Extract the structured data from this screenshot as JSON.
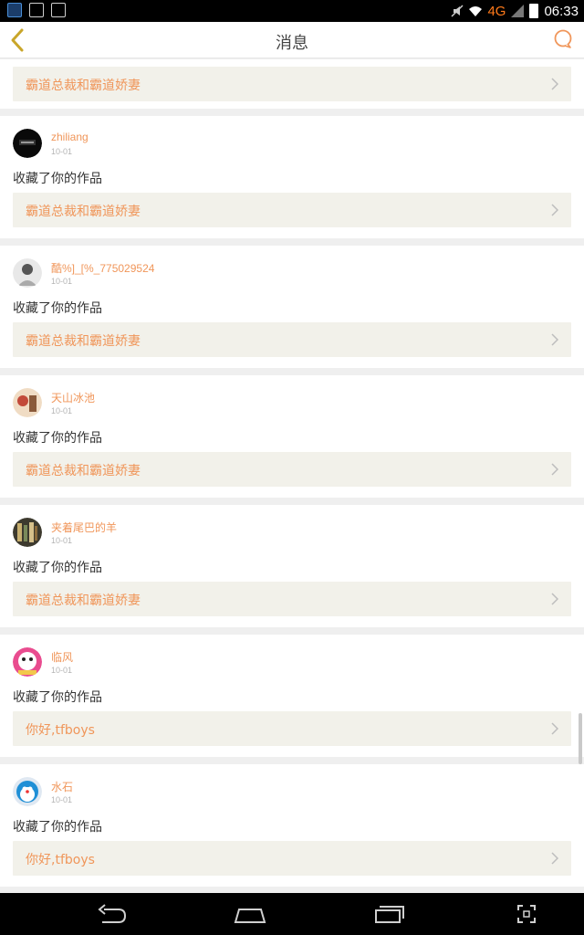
{
  "status_bar": {
    "network": "4G",
    "time": "06:33"
  },
  "header": {
    "title": "消息",
    "back_icon": "back-chevron-icon",
    "right_icon": "chat-bubble-icon"
  },
  "top_item": {
    "work_title": "霸道总裁和霸道娇妻"
  },
  "notifications": [
    {
      "user": "zhiliang",
      "date": "10-01",
      "action": "收藏了你的作品",
      "work_title": "霸道总裁和霸道娇妻",
      "avatar": "dark"
    },
    {
      "user": "酷%]_[%_775029524",
      "date": "10-01",
      "action": "收藏了你的作品",
      "work_title": "霸道总裁和霸道娇妻",
      "avatar": "sketch"
    },
    {
      "user": "天山冰池",
      "date": "10-01",
      "action": "收藏了你的作品",
      "work_title": "霸道总裁和霸道娇妻",
      "avatar": "warm"
    },
    {
      "user": "夹着尾巴的羊",
      "date": "10-01",
      "action": "收藏了你的作品",
      "work_title": "霸道总裁和霸道娇妻",
      "avatar": "books"
    },
    {
      "user": "临风",
      "date": "10-01",
      "action": "收藏了你的作品",
      "work_title": "你好,tfboys",
      "avatar": "pink"
    },
    {
      "user": "水石",
      "date": "10-01",
      "action": "收藏了你的作品",
      "work_title": "你好,tfboys",
      "avatar": "blue"
    }
  ],
  "colors": {
    "accent": "#f0965a",
    "card_bg": "#ffffff",
    "page_bg": "#efefef",
    "work_bg": "#f2f1ea"
  }
}
